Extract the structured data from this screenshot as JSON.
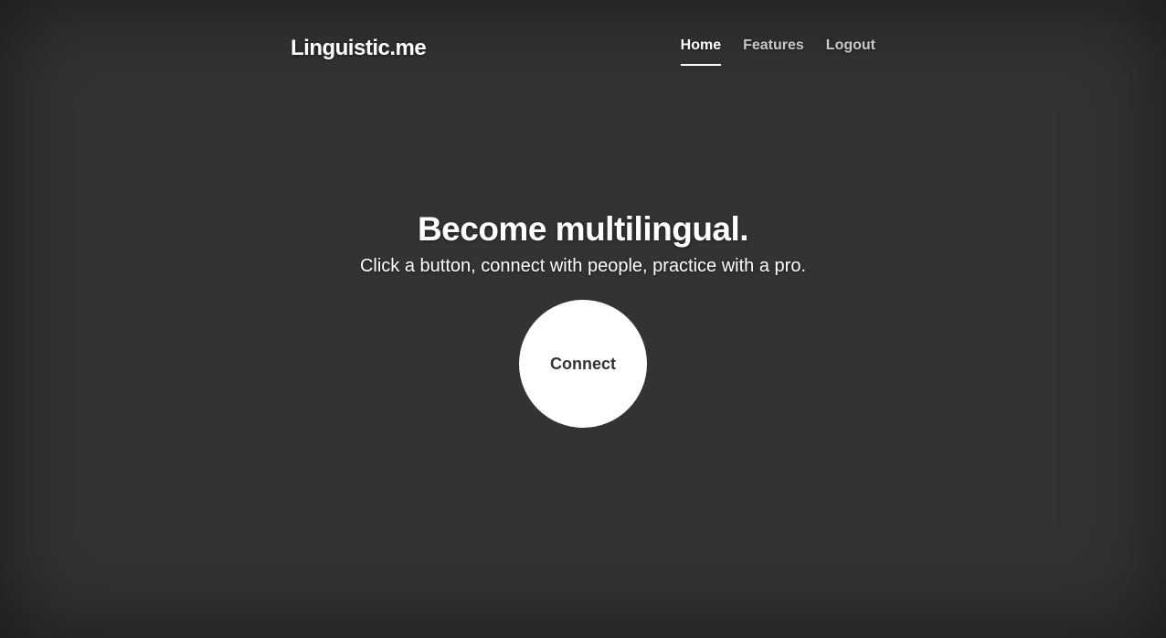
{
  "header": {
    "brand": "Linguistic.me",
    "nav": [
      {
        "label": "Home",
        "active": true
      },
      {
        "label": "Features",
        "active": false
      },
      {
        "label": "Logout",
        "active": false
      }
    ]
  },
  "hero": {
    "heading": "Become multilingual.",
    "lead": "Click a button, connect with people, practice with a pro.",
    "button_label": "Connect"
  },
  "colors": {
    "background": "#333333",
    "text": "#ffffff",
    "button_background": "#ffffff",
    "button_text": "#333333"
  }
}
